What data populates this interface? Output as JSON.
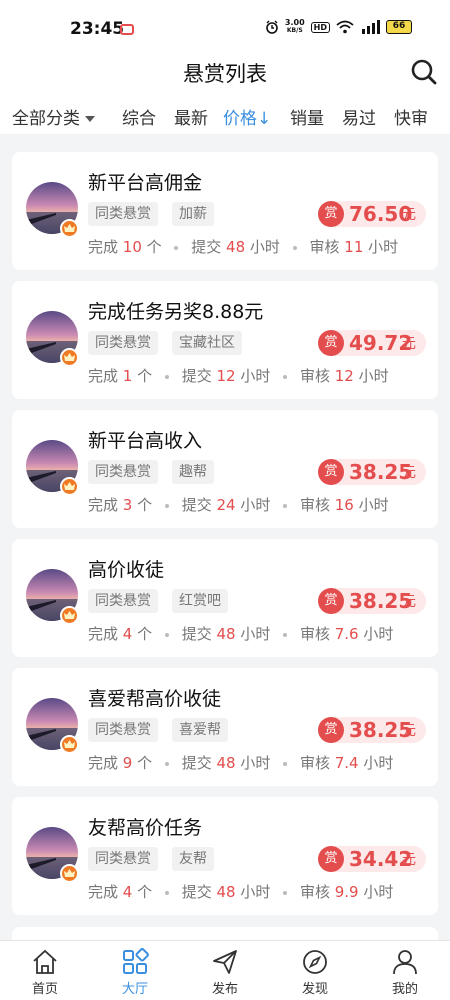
{
  "status_bar": {
    "time": "23:45",
    "net_speed_top": "3.00",
    "net_speed_bottom": "KB/S",
    "hd": "HD",
    "battery": "66"
  },
  "header": {
    "title": "悬赏列表"
  },
  "tabs": [
    {
      "label": "全部分类"
    },
    {
      "label": "综合"
    },
    {
      "label": "最新"
    },
    {
      "label": "价格↓"
    },
    {
      "label": "销量"
    },
    {
      "label": "易过"
    },
    {
      "label": "快审"
    }
  ],
  "reward_badge": "赏",
  "reward_unit": "元",
  "stat_labels": {
    "done": "完成",
    "count_unit": "个",
    "submit": "提交",
    "review": "审核",
    "hours": "小时"
  },
  "tasks": [
    {
      "title": "新平台高佣金",
      "tag1": "同类悬赏",
      "tag2": "加薪",
      "amount": "76.50",
      "done": "10",
      "submit_hours": "48",
      "review_hours": "11"
    },
    {
      "title": "完成任务另奖8.88元",
      "tag1": "同类悬赏",
      "tag2": "宝藏社区",
      "amount": "49.72",
      "done": "1",
      "submit_hours": "12",
      "review_hours": "12"
    },
    {
      "title": "新平台高收入",
      "tag1": "同类悬赏",
      "tag2": "趣帮",
      "amount": "38.25",
      "done": "3",
      "submit_hours": "24",
      "review_hours": "16"
    },
    {
      "title": "高价收徒",
      "tag1": "同类悬赏",
      "tag2": "红赏吧",
      "amount": "38.25",
      "done": "4",
      "submit_hours": "48",
      "review_hours": "7.6"
    },
    {
      "title": "喜爱帮高价收徒",
      "tag1": "同类悬赏",
      "tag2": "喜爱帮",
      "amount": "38.25",
      "done": "9",
      "submit_hours": "48",
      "review_hours": "7.4"
    },
    {
      "title": "友帮高价任务",
      "tag1": "同类悬赏",
      "tag2": "友帮",
      "amount": "34.42",
      "done": "4",
      "submit_hours": "48",
      "review_hours": "9.9"
    }
  ],
  "bottom_nav": [
    {
      "label": "首页",
      "icon": "home-icon"
    },
    {
      "label": "大厅",
      "icon": "grid-icon"
    },
    {
      "label": "发布",
      "icon": "send-icon"
    },
    {
      "label": "发现",
      "icon": "compass-icon"
    },
    {
      "label": "我的",
      "icon": "person-icon"
    }
  ],
  "colors": {
    "accent": "#3b8fe0",
    "reward_red": "#e44d4d",
    "background": "#f3f4f6"
  }
}
